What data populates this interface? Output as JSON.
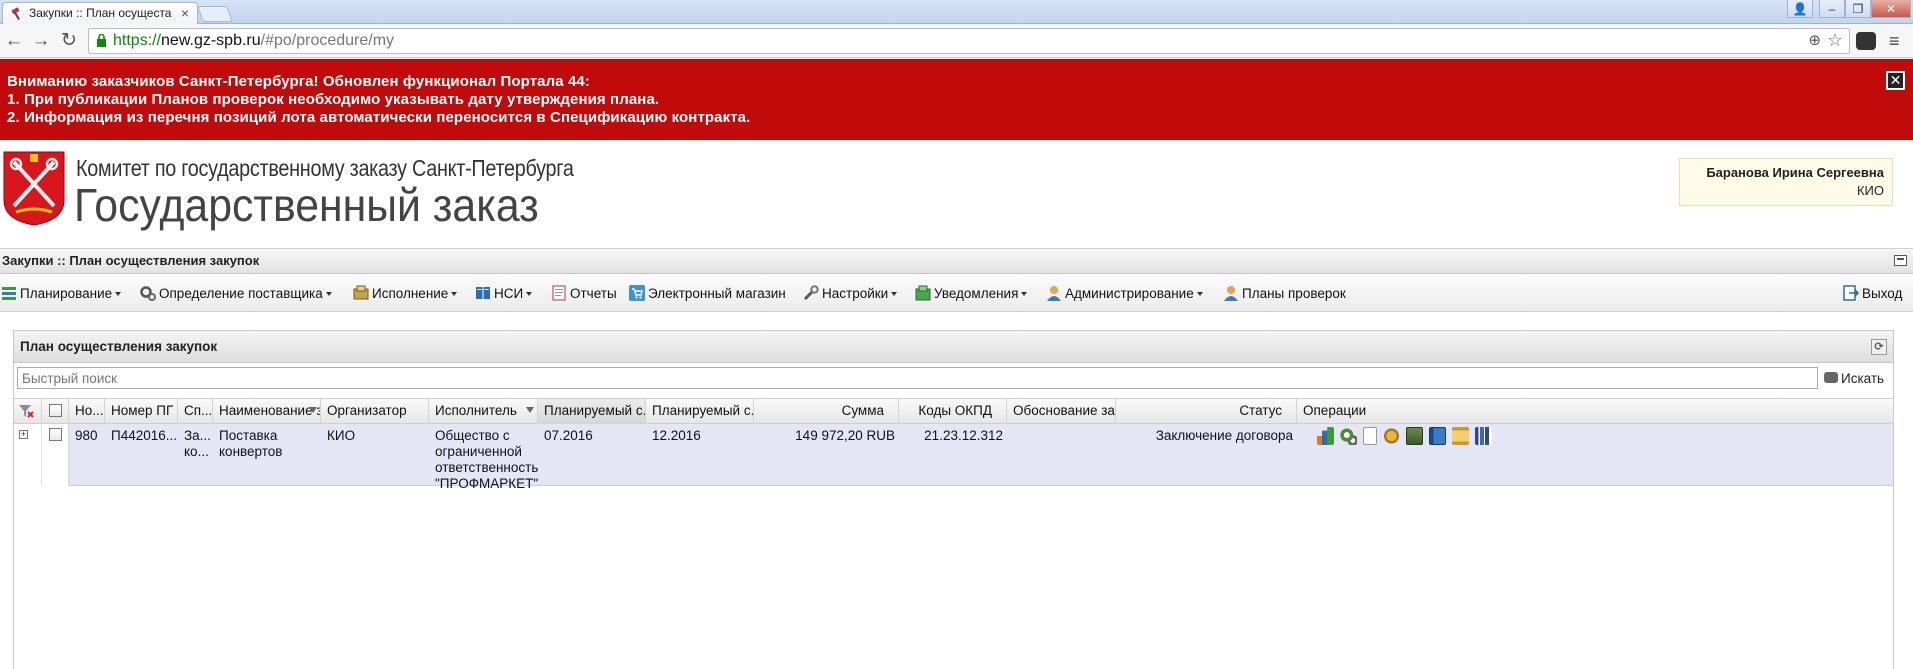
{
  "browser": {
    "tab_title": "Закупки :: План осущеста",
    "tab_close": "×",
    "url_scheme": "https://",
    "url_host": "new.gz-spb.ru",
    "url_path": "/#po/procedure/my",
    "nav_back": "←",
    "nav_forward": "→",
    "nav_reload": "↻",
    "zoom_glyph": "⊕",
    "star_glyph": "☆",
    "menu_glyph": "≡",
    "win_user": "👤",
    "win_min": "–",
    "win_restore": "❐",
    "win_close": "✕"
  },
  "alert": {
    "line1": "Вниманию заказчиков Санкт-Петербурга! Обновлен функционал Портала 44:",
    "line2": "1. При публикации Планов проверок необходимо указывать дату утверждения плана.",
    "line3": "2. Информация из перечня позиций лота автоматически переносится в Спецификацию контракта.",
    "close": "✕"
  },
  "header": {
    "org_line1": "Комитет по государственному заказу Санкт-Петербурга",
    "org_line2": "Государственный заказ",
    "user_name": "Баранова Ирина Сергеевна",
    "user_org": "КИО"
  },
  "titlebar": {
    "title": "Закупки :: План осуществления закупок"
  },
  "menu": {
    "items": [
      {
        "label": "Планирование",
        "icon": "planning-icon",
        "dropdown": true
      },
      {
        "label": "Определение поставщика",
        "icon": "gears-icon",
        "dropdown": true
      },
      {
        "label": "Исполнение",
        "icon": "execution-icon",
        "dropdown": true
      },
      {
        "label": "НСИ",
        "icon": "book-icon",
        "dropdown": true
      },
      {
        "label": "Отчеты",
        "icon": "report-icon",
        "dropdown": false
      },
      {
        "label": "Электронный магазин",
        "icon": "cart-icon",
        "dropdown": false
      },
      {
        "label": "Настройки",
        "icon": "wrench-icon",
        "dropdown": true
      },
      {
        "label": "Уведомления",
        "icon": "notification-icon",
        "dropdown": true
      },
      {
        "label": "Администрирование",
        "icon": "admin-user-icon",
        "dropdown": true
      },
      {
        "label": "Планы проверок",
        "icon": "inspection-user-icon",
        "dropdown": false
      }
    ],
    "exit_label": "Выход"
  },
  "panel": {
    "title": "План осуществления закупок",
    "refresh": "⟳",
    "search_placeholder": "Быстрый поиск",
    "search_button": "Искать"
  },
  "grid": {
    "columns": [
      "Но...",
      "Номер ПГ",
      "Сп...",
      "Наименование з...",
      "Организатор",
      "Исполнитель",
      "Планируемый с...",
      "Планируемый с...",
      "Сумма",
      "Коды ОКПД",
      "Обоснование за...",
      "Статус",
      "Операции"
    ],
    "rows": [
      {
        "expand": "+",
        "num": "980",
        "pg_number": "П442016...",
        "method_line1": "За...",
        "method_line2": "ко...",
        "name_line1": "Поставка",
        "name_line2": "конвертов",
        "organizer": "КИО",
        "executor_line1": "Общество с",
        "executor_line2": "ограниченной",
        "executor_line3": "ответственностью",
        "executor_line4": "\"ПРОФМАРКЕТ\"",
        "planned_start": "07.2016",
        "planned_end": "12.2016",
        "sum": "149 972,20 RUB",
        "okpd": "21.23.12.312",
        "justification": "",
        "status": "Заключение договора",
        "operations": [
          "chart-icon",
          "gears-icon",
          "document-icon",
          "emblem-icon",
          "contract-icon",
          "notebook-icon",
          "scroll-icon",
          "books-icon"
        ]
      }
    ]
  },
  "colors": {
    "alert_bg": "#c10a0a",
    "row_bg": "#e4e6f6",
    "user_box_bg": "#fffbe8"
  }
}
